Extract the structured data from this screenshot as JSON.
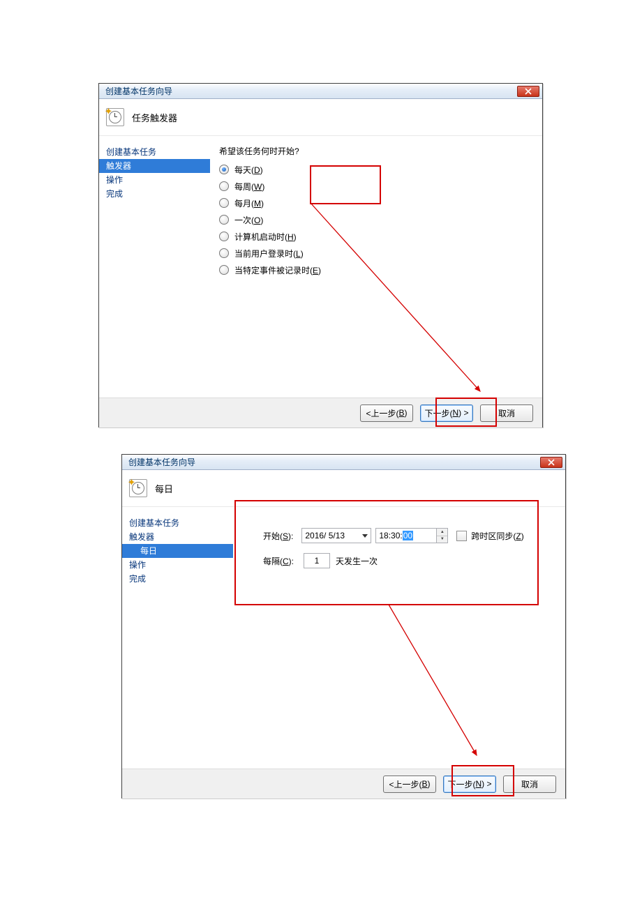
{
  "window_title": "创建基本任务向导",
  "close_name": "close",
  "w1": {
    "heading": "任务触发器",
    "sidebar": [
      "创建基本任务",
      "触发器",
      "操作",
      "完成"
    ],
    "selected_index": 1,
    "question": "希望该任务何时开始?",
    "options": [
      {
        "label": "每天(",
        "hot": "D",
        "tail": ")",
        "checked": true
      },
      {
        "label": "每周(",
        "hot": "W",
        "tail": ")",
        "checked": false
      },
      {
        "label": "每月(",
        "hot": "M",
        "tail": ")",
        "checked": false
      },
      {
        "label": "一次(",
        "hot": "O",
        "tail": ")",
        "checked": false
      },
      {
        "label": "计算机启动时(",
        "hot": "H",
        "tail": ")",
        "checked": false
      },
      {
        "label": "当前用户登录时(",
        "hot": "L",
        "tail": ")",
        "checked": false
      },
      {
        "label": "当特定事件被记录时(",
        "hot": "E",
        "tail": ")",
        "checked": false
      }
    ]
  },
  "w2": {
    "heading": "每日",
    "sidebar": [
      "创建基本任务",
      "触发器",
      "每日",
      "操作",
      "完成"
    ],
    "selected_index": 2,
    "sub_indexes": [
      2
    ],
    "start_label_a": "开始(",
    "start_hot": "S",
    "start_label_b": "):",
    "date": "2016/ 5/13",
    "time_prefix": "18:30:",
    "time_sel": "00",
    "tz_a": "跨时区同步(",
    "tz_hot": "Z",
    "tz_b": ")",
    "every_a": "每隔(",
    "every_hot": "C",
    "every_b": "):",
    "every_n": "1",
    "every_tail": "天发生一次"
  },
  "buttons": {
    "back_a": "<上一步(",
    "back_hot": "B",
    "back_b": ")",
    "next_a": "下一步(",
    "next_hot": "N",
    "next_b": ") >",
    "cancel": "取消"
  }
}
